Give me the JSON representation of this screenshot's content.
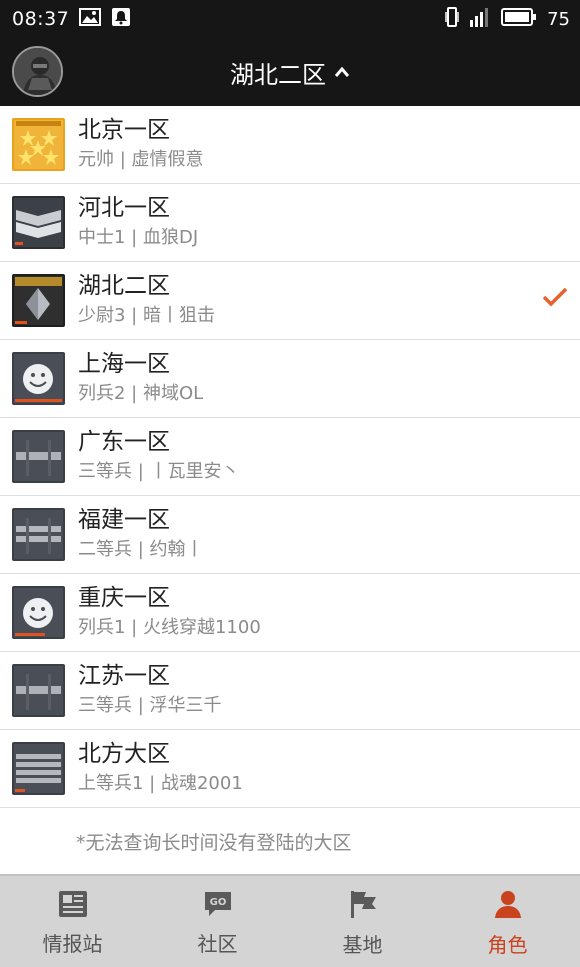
{
  "status_bar": {
    "time": "08:37",
    "icons": [
      "image-icon",
      "notification-icon",
      "vibrate-icon",
      "signal-icon",
      "battery-icon"
    ],
    "battery": "75"
  },
  "header": {
    "title": "湖北二区",
    "avatar_icon": "avatar-icon",
    "dropdown_icon": "chevron-up-icon",
    "background": "#161616"
  },
  "servers": [
    {
      "name": "北京一区",
      "detail": "元帅 | 虚情假意",
      "badge": "marshal",
      "badge_text": "MARSHAL",
      "selected": false
    },
    {
      "name": "河北一区",
      "detail": "中士1 | 血狼DJ",
      "badge": "sfc",
      "badge_text": "SFC",
      "selected": false
    },
    {
      "name": "湖北二区",
      "detail": "少尉3 | 暗丨狙击",
      "badge": "second-lieutenant",
      "badge_text": "SECOND LIEUTENANT",
      "selected": true
    },
    {
      "name": "上海一区",
      "detail": "列兵2 | 神域OL",
      "badge": "trainee",
      "badge_text": "TRAINEE",
      "selected": false
    },
    {
      "name": "广东一区",
      "detail": "三等兵 | 丨瓦里安丶",
      "badge": "private",
      "badge_text": "PRIVATE",
      "selected": false
    },
    {
      "name": "福建一区",
      "detail": "二等兵 | 约翰丨",
      "badge": "pfc",
      "badge_text": "PFC",
      "selected": false
    },
    {
      "name": "重庆一区",
      "detail": "列兵1 | 火线穿越1100",
      "badge": "trainee",
      "badge_text": "TRAINEE",
      "selected": false
    },
    {
      "name": "江苏一区",
      "detail": "三等兵 | 浮华三千",
      "badge": "private",
      "badge_text": "PRIVATE",
      "selected": false
    },
    {
      "name": "北方大区",
      "detail": "上等兵1 | 战魂2001",
      "badge": "sergeant",
      "badge_text": "SERGEANT",
      "selected": false
    }
  ],
  "note": "*无法查询长时间没有登陆的大区",
  "bottom_nav": [
    {
      "label": "情报站",
      "icon": "newspaper-icon",
      "active": false
    },
    {
      "label": "社区",
      "icon": "chat-bubble-icon",
      "active": false
    },
    {
      "label": "基地",
      "icon": "flag-icon",
      "active": false
    },
    {
      "label": "角色",
      "icon": "person-icon",
      "active": true
    }
  ],
  "colors": {
    "accent": "#c8431e",
    "check": "#e8612c",
    "nav_background": "#d4d4d4",
    "text_primary": "#222222",
    "text_secondary": "#8b8b8b"
  }
}
